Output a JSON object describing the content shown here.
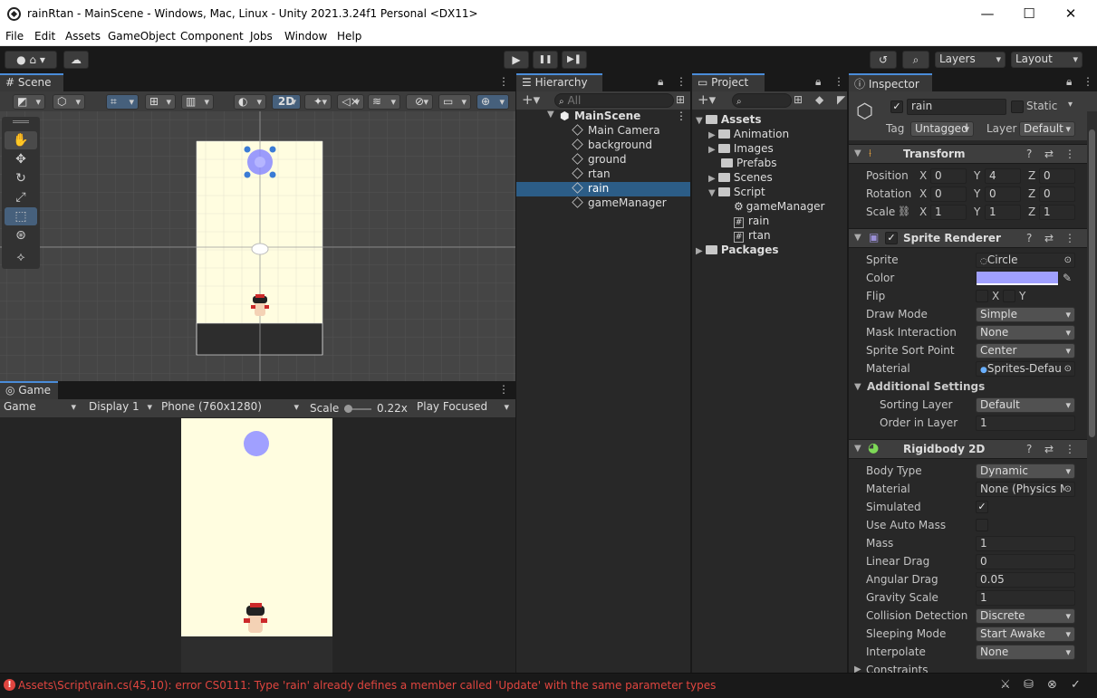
{
  "window": {
    "title": "rainRtan - MainScene - Windows, Mac, Linux - Unity 2021.3.24f1 Personal <DX11>",
    "controls": {
      "minimize": "—",
      "maximize": "☐",
      "close": "✕"
    }
  },
  "menu": [
    "File",
    "Edit",
    "Assets",
    "GameObject",
    "Component",
    "Jobs",
    "Window",
    "Help"
  ],
  "toolbar": {
    "play": "▶",
    "pause": "❚❚",
    "step": "▶❚",
    "layers": "Layers",
    "layout": "Layout"
  },
  "scene": {
    "tab": "Scene",
    "mode_2d": "2D"
  },
  "game": {
    "tab": "Game",
    "view_dropdown": "Game",
    "display": "Display 1",
    "resolution": "Phone (760x1280)",
    "scale_label": "Scale",
    "scale_value": "0.22x",
    "play_mode": "Play Focused"
  },
  "hierarchy": {
    "tab": "Hierarchy",
    "search_placeholder": "All",
    "root": "MainScene",
    "items": [
      "Main Camera",
      "background",
      "ground",
      "rtan",
      "rain",
      "gameManager"
    ],
    "selected_index": 4
  },
  "project": {
    "tab": "Project",
    "assets": "Assets",
    "folders": [
      "Animation",
      "Images",
      "Prefabs",
      "Scenes",
      "Script"
    ],
    "script_items": [
      "gameManager",
      "rain",
      "rtan"
    ],
    "packages": "Packages"
  },
  "inspector": {
    "tab": "Inspector",
    "object_name": "rain",
    "static_label": "Static",
    "tag_label": "Tag",
    "tag_value": "Untagged",
    "layer_label": "Layer",
    "layer_value": "Default",
    "transform": {
      "title": "Transform",
      "position_label": "Position",
      "rotation_label": "Rotation",
      "scale_label": "Scale",
      "position": [
        "0",
        "4",
        "0"
      ],
      "rotation": [
        "0",
        "0",
        "0"
      ],
      "scale": [
        "1",
        "1",
        "1"
      ],
      "axes": [
        "X",
        "Y",
        "Z"
      ]
    },
    "sprite_renderer": {
      "title": "Sprite Renderer",
      "sprite_label": "Sprite",
      "sprite_value": "Circle",
      "color_label": "Color",
      "color_value": "#a0a0ff",
      "flip_label": "Flip",
      "flip_x": "X",
      "flip_y": "Y",
      "draw_mode_label": "Draw Mode",
      "draw_mode_value": "Simple",
      "mask_label": "Mask Interaction",
      "mask_value": "None",
      "sort_point_label": "Sprite Sort Point",
      "sort_point_value": "Center",
      "material_label": "Material",
      "material_value": "Sprites-Defau",
      "additional_label": "Additional Settings",
      "sorting_layer_label": "Sorting Layer",
      "sorting_layer_value": "Default",
      "order_label": "Order in Layer",
      "order_value": "1"
    },
    "rigidbody": {
      "title": "Rigidbody 2D",
      "body_type_label": "Body Type",
      "body_type_value": "Dynamic",
      "material_label": "Material",
      "material_value": "None (Physics M",
      "simulated_label": "Simulated",
      "simulated_check": "✓",
      "auto_mass_label": "Use Auto Mass",
      "mass_label": "Mass",
      "mass_value": "1",
      "linear_drag_label": "Linear Drag",
      "linear_drag_value": "0",
      "angular_drag_label": "Angular Drag",
      "angular_drag_value": "0.05",
      "gravity_label": "Gravity Scale",
      "gravity_value": "1",
      "collision_label": "Collision Detection",
      "collision_value": "Discrete",
      "sleeping_label": "Sleeping Mode",
      "sleeping_value": "Start Awake",
      "interpolate_label": "Interpolate",
      "interpolate_value": "None",
      "constraints_label": "Constraints"
    }
  },
  "status": {
    "error": "Assets\\Script\\rain.cs(45,10): error CS0111: Type 'rain' already defines a member called 'Update' with the same parameter types"
  },
  "colors": {
    "accent": "#4a8cd9",
    "selection": "#2c5d87",
    "error": "#e0453f",
    "background_sprite": "#fffde0",
    "rain_sprite": "#a0a0ff"
  }
}
